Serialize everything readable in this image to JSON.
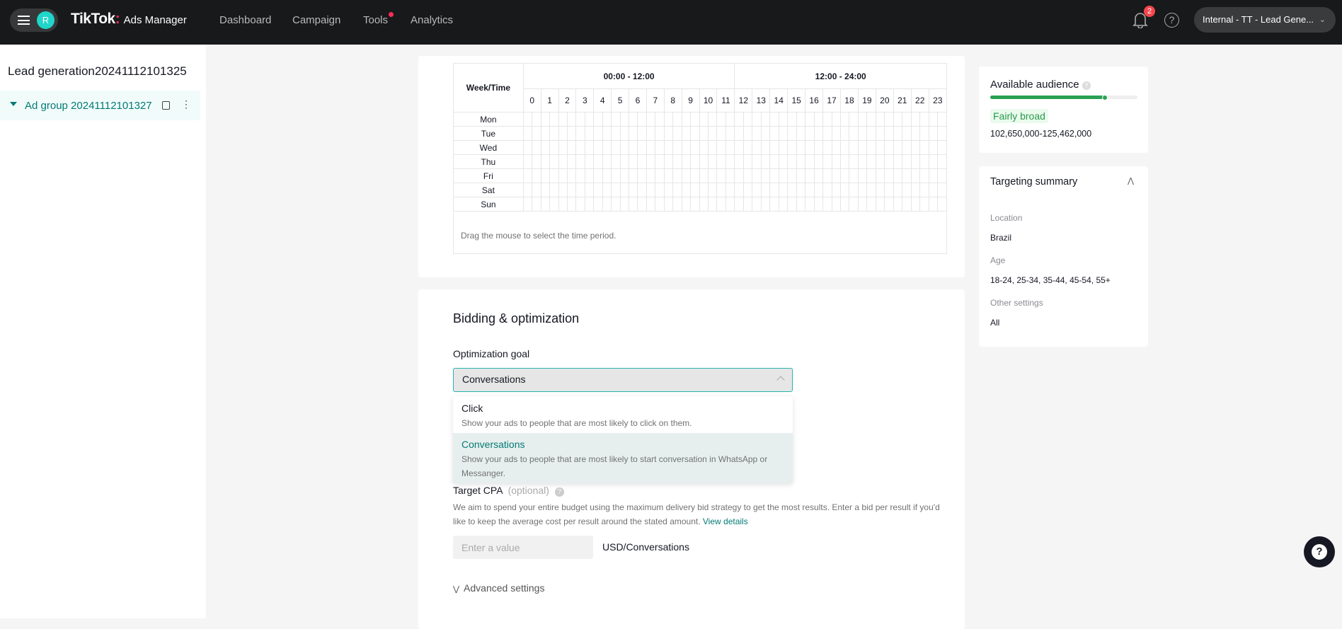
{
  "topbar": {
    "avatar_letter": "R",
    "logo": "TikTok",
    "logo_sub": "Ads Manager",
    "nav": [
      "Dashboard",
      "Campaign",
      "Tools",
      "Analytics"
    ],
    "notification_count": "2",
    "account": "Internal - TT - Lead Gene..."
  },
  "sidebar": {
    "campaign": "Lead generation20241112101325",
    "ad_group": "Ad group 20241112101327"
  },
  "schedule": {
    "header": "Week/Time",
    "range1": "00:00 - 12:00",
    "range2": "12:00 - 24:00",
    "hours": [
      "0",
      "1",
      "2",
      "3",
      "4",
      "5",
      "6",
      "7",
      "8",
      "9",
      "10",
      "11",
      "12",
      "13",
      "14",
      "15",
      "16",
      "17",
      "18",
      "19",
      "20",
      "21",
      "22",
      "23"
    ],
    "days": [
      "Mon",
      "Tue",
      "Wed",
      "Thu",
      "Fri",
      "Sat",
      "Sun"
    ],
    "hint": "Drag the mouse to select the time period."
  },
  "bidding": {
    "title": "Bidding & optimization",
    "goal_label": "Optimization goal",
    "goal_value": "Conversations",
    "options": [
      {
        "title": "Click",
        "desc": "Show your ads to people that are most likely to click on them.",
        "selected": false
      },
      {
        "title": "Conversations",
        "desc": "Show your ads to people that are most likely to start conversation in WhatsApp or Messanger.",
        "selected": true
      }
    ],
    "cpa_label": "Target CPA",
    "cpa_optional": "(optional)",
    "cpa_desc": "We aim to spend your entire budget using the maximum delivery bid strategy to get the most results. Enter a bid per result if you'd like to keep the average cost per result around the stated amount.",
    "view_details": "View details",
    "cpa_placeholder": "Enter a value",
    "cpa_unit": "USD/Conversations",
    "advanced": "Advanced settings"
  },
  "audience": {
    "title": "Available audience",
    "level_percent": 78,
    "tag": "Fairly broad",
    "range": "102,650,000-125,462,000"
  },
  "summary": {
    "title": "Targeting summary",
    "items": [
      {
        "k": "Location",
        "v": "Brazil"
      },
      {
        "k": "Age",
        "v": "18-24, 25-34, 35-44, 45-54, 55+"
      },
      {
        "k": "Other settings",
        "v": "All"
      }
    ]
  },
  "colors": {
    "accent": "#047a74",
    "topbar": "#18191b",
    "audience_green": "#2aa152"
  }
}
